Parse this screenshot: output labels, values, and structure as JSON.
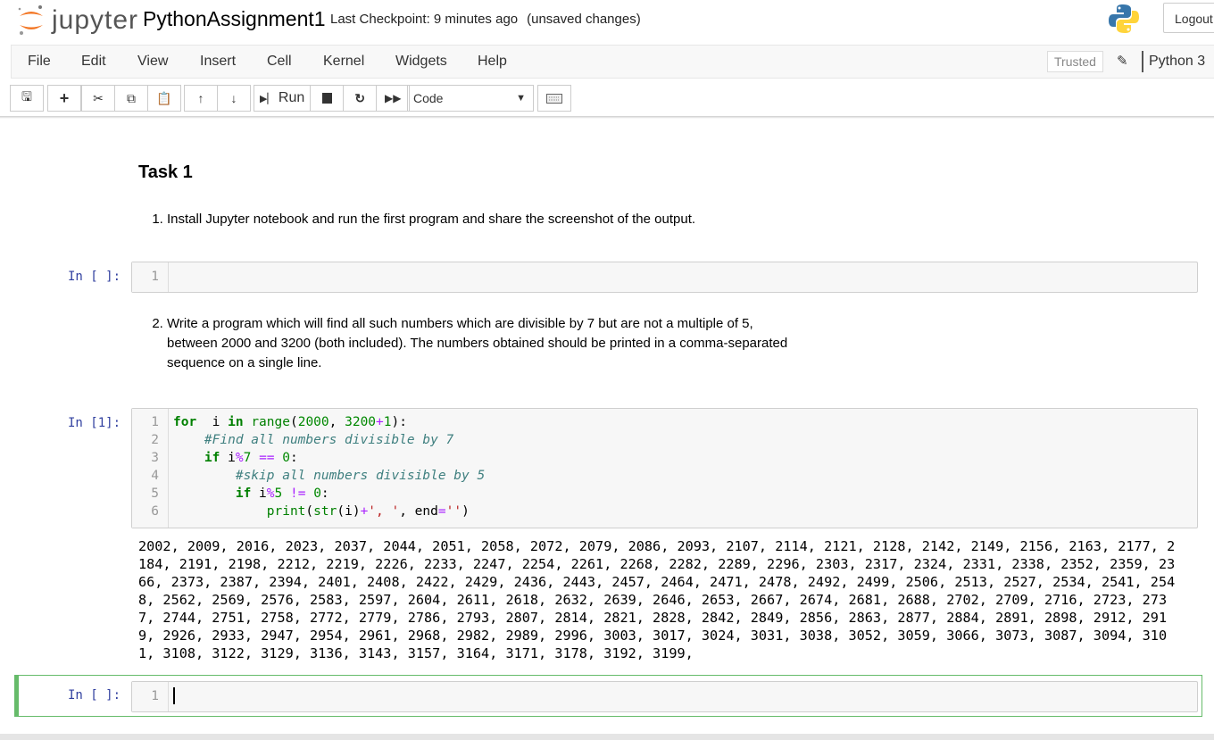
{
  "header": {
    "logo_text": "jupyter",
    "notebook_name": "PythonAssignment1",
    "checkpoint": "Last Checkpoint: 9 minutes ago",
    "unsaved": "(unsaved changes)",
    "logout": "Logout"
  },
  "menubar": {
    "items": [
      "File",
      "Edit",
      "View",
      "Insert",
      "Cell",
      "Kernel",
      "Widgets",
      "Help"
    ],
    "trusted": "Trusted",
    "kernel": "Python 3"
  },
  "toolbar": {
    "run": "Run",
    "cell_type": "Code"
  },
  "markdown": {
    "task_title": "Task 1",
    "item1": "Install Jupyter notebook and run the first program and share the screenshot of the output.",
    "item2": "Write a program which will find all such numbers which are divisible by 7 but are not a multiple of 5, between 2000 and 3200 (both included). The numbers obtained should be printed in a comma-separated sequence on a single line."
  },
  "cells": {
    "c1": {
      "prompt": "In [ ]:",
      "line": "1"
    },
    "c2": {
      "prompt": "In [1]:",
      "lines": [
        [
          [
            "kw",
            "for"
          ],
          [
            "",
            "  i "
          ],
          [
            "kw",
            "in"
          ],
          [
            "",
            ""
          ],
          [
            "bi",
            " range"
          ],
          [
            "",
            "("
          ],
          [
            "num",
            "2000"
          ],
          [
            "",
            ", "
          ],
          [
            "num",
            "3200"
          ],
          [
            "op",
            "+"
          ],
          [
            "num",
            "1"
          ],
          [
            "",
            "):"
          ]
        ],
        [
          [
            "",
            "    "
          ],
          [
            "cm",
            "#Find all numbers divisible by 7"
          ]
        ],
        [
          [
            "",
            "    "
          ],
          [
            "kw",
            "if"
          ],
          [
            "",
            " i"
          ],
          [
            "op",
            "%"
          ],
          [
            "num",
            "7"
          ],
          [
            "",
            " "
          ],
          [
            "op",
            "=="
          ],
          [
            "",
            " "
          ],
          [
            "num",
            "0"
          ],
          [
            "",
            ":"
          ]
        ],
        [
          [
            "",
            "        "
          ],
          [
            "cm",
            "#skip all numbers divisible by 5"
          ]
        ],
        [
          [
            "",
            "        "
          ],
          [
            "kw",
            "if"
          ],
          [
            "",
            " i"
          ],
          [
            "op",
            "%"
          ],
          [
            "num",
            "5"
          ],
          [
            "",
            " "
          ],
          [
            "op",
            "!="
          ],
          [
            "",
            " "
          ],
          [
            "num",
            "0"
          ],
          [
            "",
            ":"
          ]
        ],
        [
          [
            "",
            "            "
          ],
          [
            "bi",
            "print"
          ],
          [
            "",
            "("
          ],
          [
            "bi",
            "str"
          ],
          [
            "",
            "(i)"
          ],
          [
            "op",
            "+"
          ],
          [
            "str",
            "', '"
          ],
          [
            "",
            ", end"
          ],
          [
            "op",
            "="
          ],
          [
            "str",
            "''"
          ],
          [
            "",
            ")"
          ]
        ]
      ],
      "output": "2002, 2009, 2016, 2023, 2037, 2044, 2051, 2058, 2072, 2079, 2086, 2093, 2107, 2114, 2121, 2128, 2142, 2149, 2156, 2163, 2177, 2184, 2191, 2198, 2212, 2219, 2226, 2233, 2247, 2254, 2261, 2268, 2282, 2289, 2296, 2303, 2317, 2324, 2331, 2338, 2352, 2359, 2366, 2373, 2387, 2394, 2401, 2408, 2422, 2429, 2436, 2443, 2457, 2464, 2471, 2478, 2492, 2499, 2506, 2513, 2527, 2534, 2541, 2548, 2562, 2569, 2576, 2583, 2597, 2604, 2611, 2618, 2632, 2639, 2646, 2653, 2667, 2674, 2681, 2688, 2702, 2709, 2716, 2723, 2737, 2744, 2751, 2758, 2772, 2779, 2786, 2793, 2807, 2814, 2821, 2828, 2842, 2849, 2856, 2863, 2877, 2884, 2891, 2898, 2912, 2919, 2926, 2933, 2947, 2954, 2961, 2968, 2982, 2989, 2996, 3003, 3017, 3024, 3031, 3038, 3052, 3059, 3066, 3073, 3087, 3094, 3101, 3108, 3122, 3129, 3136, 3143, 3157, 3164, 3171, 3178, 3192, 3199, "
    },
    "c3": {
      "prompt": "In [ ]:",
      "line": "1"
    }
  },
  "colors": {
    "selected_border": "#66bb6a",
    "prompt": "#303f9f",
    "jupyter_orange": "#f37726"
  }
}
